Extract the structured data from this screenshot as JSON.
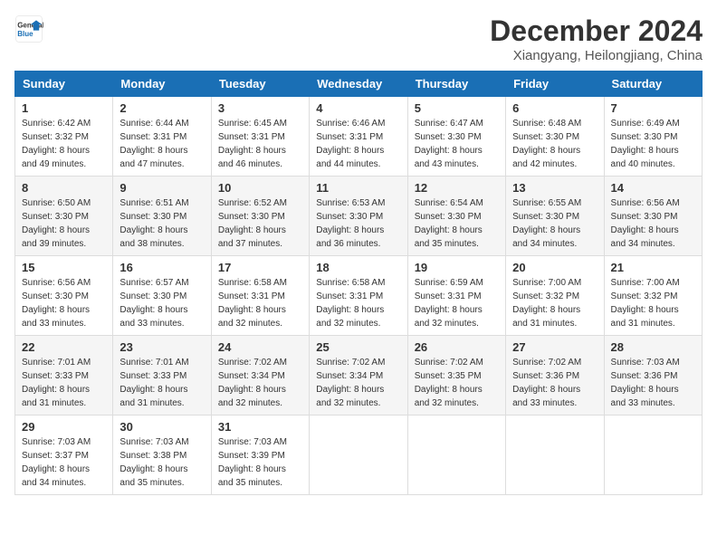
{
  "header": {
    "logo_general": "General",
    "logo_blue": "Blue",
    "month_title": "December 2024",
    "location": "Xiangyang, Heilongjiang, China"
  },
  "weekdays": [
    "Sunday",
    "Monday",
    "Tuesday",
    "Wednesday",
    "Thursday",
    "Friday",
    "Saturday"
  ],
  "weeks": [
    [
      {
        "day": "1",
        "sunrise": "6:42 AM",
        "sunset": "3:32 PM",
        "daylight": "8 hours and 49 minutes."
      },
      {
        "day": "2",
        "sunrise": "6:44 AM",
        "sunset": "3:31 PM",
        "daylight": "8 hours and 47 minutes."
      },
      {
        "day": "3",
        "sunrise": "6:45 AM",
        "sunset": "3:31 PM",
        "daylight": "8 hours and 46 minutes."
      },
      {
        "day": "4",
        "sunrise": "6:46 AM",
        "sunset": "3:31 PM",
        "daylight": "8 hours and 44 minutes."
      },
      {
        "day": "5",
        "sunrise": "6:47 AM",
        "sunset": "3:30 PM",
        "daylight": "8 hours and 43 minutes."
      },
      {
        "day": "6",
        "sunrise": "6:48 AM",
        "sunset": "3:30 PM",
        "daylight": "8 hours and 42 minutes."
      },
      {
        "day": "7",
        "sunrise": "6:49 AM",
        "sunset": "3:30 PM",
        "daylight": "8 hours and 40 minutes."
      }
    ],
    [
      {
        "day": "8",
        "sunrise": "6:50 AM",
        "sunset": "3:30 PM",
        "daylight": "8 hours and 39 minutes."
      },
      {
        "day": "9",
        "sunrise": "6:51 AM",
        "sunset": "3:30 PM",
        "daylight": "8 hours and 38 minutes."
      },
      {
        "day": "10",
        "sunrise": "6:52 AM",
        "sunset": "3:30 PM",
        "daylight": "8 hours and 37 minutes."
      },
      {
        "day": "11",
        "sunrise": "6:53 AM",
        "sunset": "3:30 PM",
        "daylight": "8 hours and 36 minutes."
      },
      {
        "day": "12",
        "sunrise": "6:54 AM",
        "sunset": "3:30 PM",
        "daylight": "8 hours and 35 minutes."
      },
      {
        "day": "13",
        "sunrise": "6:55 AM",
        "sunset": "3:30 PM",
        "daylight": "8 hours and 34 minutes."
      },
      {
        "day": "14",
        "sunrise": "6:56 AM",
        "sunset": "3:30 PM",
        "daylight": "8 hours and 34 minutes."
      }
    ],
    [
      {
        "day": "15",
        "sunrise": "6:56 AM",
        "sunset": "3:30 PM",
        "daylight": "8 hours and 33 minutes."
      },
      {
        "day": "16",
        "sunrise": "6:57 AM",
        "sunset": "3:30 PM",
        "daylight": "8 hours and 33 minutes."
      },
      {
        "day": "17",
        "sunrise": "6:58 AM",
        "sunset": "3:31 PM",
        "daylight": "8 hours and 32 minutes."
      },
      {
        "day": "18",
        "sunrise": "6:58 AM",
        "sunset": "3:31 PM",
        "daylight": "8 hours and 32 minutes."
      },
      {
        "day": "19",
        "sunrise": "6:59 AM",
        "sunset": "3:31 PM",
        "daylight": "8 hours and 32 minutes."
      },
      {
        "day": "20",
        "sunrise": "7:00 AM",
        "sunset": "3:32 PM",
        "daylight": "8 hours and 31 minutes."
      },
      {
        "day": "21",
        "sunrise": "7:00 AM",
        "sunset": "3:32 PM",
        "daylight": "8 hours and 31 minutes."
      }
    ],
    [
      {
        "day": "22",
        "sunrise": "7:01 AM",
        "sunset": "3:33 PM",
        "daylight": "8 hours and 31 minutes."
      },
      {
        "day": "23",
        "sunrise": "7:01 AM",
        "sunset": "3:33 PM",
        "daylight": "8 hours and 31 minutes."
      },
      {
        "day": "24",
        "sunrise": "7:02 AM",
        "sunset": "3:34 PM",
        "daylight": "8 hours and 32 minutes."
      },
      {
        "day": "25",
        "sunrise": "7:02 AM",
        "sunset": "3:34 PM",
        "daylight": "8 hours and 32 minutes."
      },
      {
        "day": "26",
        "sunrise": "7:02 AM",
        "sunset": "3:35 PM",
        "daylight": "8 hours and 32 minutes."
      },
      {
        "day": "27",
        "sunrise": "7:02 AM",
        "sunset": "3:36 PM",
        "daylight": "8 hours and 33 minutes."
      },
      {
        "day": "28",
        "sunrise": "7:03 AM",
        "sunset": "3:36 PM",
        "daylight": "8 hours and 33 minutes."
      }
    ],
    [
      {
        "day": "29",
        "sunrise": "7:03 AM",
        "sunset": "3:37 PM",
        "daylight": "8 hours and 34 minutes."
      },
      {
        "day": "30",
        "sunrise": "7:03 AM",
        "sunset": "3:38 PM",
        "daylight": "8 hours and 35 minutes."
      },
      {
        "day": "31",
        "sunrise": "7:03 AM",
        "sunset": "3:39 PM",
        "daylight": "8 hours and 35 minutes."
      },
      null,
      null,
      null,
      null
    ]
  ],
  "labels": {
    "sunrise_prefix": "Sunrise: ",
    "sunset_prefix": "Sunset: ",
    "daylight_label": "Daylight hours"
  }
}
